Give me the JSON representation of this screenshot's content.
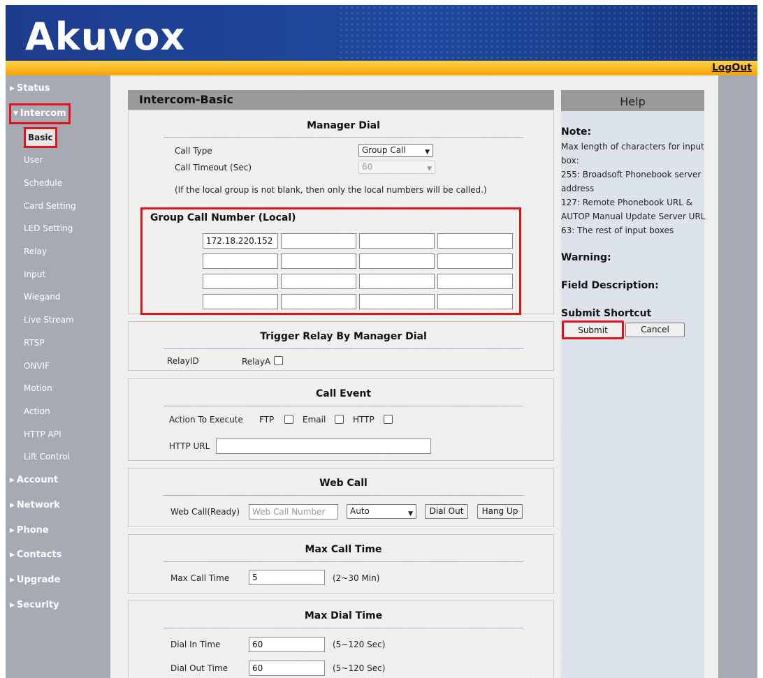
{
  "header": {
    "logo": "Akuvox",
    "logout": "LogOut"
  },
  "sidebar": {
    "groups_top": [
      {
        "label": "Status",
        "expanded": false
      },
      {
        "label": "Intercom",
        "expanded": true
      }
    ],
    "sub_items": [
      "Basic",
      "User",
      "Schedule",
      "Card Setting",
      "LED Setting",
      "Relay",
      "Input",
      "Wiegand",
      "Live Stream",
      "RTSP",
      "ONVIF",
      "Motion",
      "Action",
      "HTTP API",
      "Lift Control"
    ],
    "groups_bottom": [
      "Account",
      "Network",
      "Phone",
      "Contacts",
      "Upgrade",
      "Security"
    ]
  },
  "page_title": "Intercom-Basic",
  "manager_dial": {
    "title": "Manager Dial",
    "call_type_label": "Call Type",
    "call_type_value": "Group Call",
    "call_timeout_label": "Call Timeout (Sec)",
    "call_timeout_value": "60",
    "note": "(If the local group is not blank, then only the local numbers will be called.)",
    "group_title": "Group Call Number (Local)",
    "group_numbers": [
      "172.18.220.152",
      "",
      "",
      "",
      "",
      "",
      "",
      "",
      "",
      "",
      "",
      "",
      "",
      "",
      "",
      ""
    ]
  },
  "trigger_relay": {
    "title": "Trigger Relay By Manager Dial",
    "relay_id_label": "RelayID",
    "relay_a_label": "RelayA",
    "relay_a_checked": false
  },
  "call_event": {
    "title": "Call Event",
    "action_label": "Action To Execute",
    "ftp_label": "FTP",
    "email_label": "Email",
    "http_label": "HTTP",
    "http_url_label": "HTTP URL",
    "http_url_value": ""
  },
  "web_call": {
    "title": "Web Call",
    "label": "Web Call(Ready)",
    "number_placeholder": "Web Call Number",
    "mode_value": "Auto",
    "dial_out": "Dial Out",
    "hang_up": "Hang Up"
  },
  "max_call_time": {
    "title": "Max Call Time",
    "label": "Max Call Time",
    "value": "5",
    "range": "(2~30 Min)"
  },
  "max_dial_time": {
    "title": "Max Dial Time",
    "dial_in_label": "Dial In Time",
    "dial_in_value": "60",
    "dial_in_range": "(5~120 Sec)",
    "dial_out_label": "Dial Out Time",
    "dial_out_value": "60",
    "dial_out_range": "(5~120 Sec)"
  },
  "help": {
    "title": "Help",
    "note_head": "Note:",
    "note_lines": [
      "Max length of characters for input",
      "box:",
      "255: Broadsoft Phonebook server",
      "address",
      "127: Remote Phonebook URL &",
      "AUTOP Manual Update Server URL",
      "63: The rest of input boxes"
    ],
    "warning_head": "Warning:",
    "field_desc_head": "Field Description:",
    "submit_shortcut_head": "Submit Shortcut",
    "submit": "Submit",
    "cancel": "Cancel"
  },
  "colors": {
    "header_blue": "#1f4a9e",
    "bar_orange": "#f5a300",
    "sidebar_gray": "#a6abb3",
    "highlight_red": "#e8101b"
  }
}
